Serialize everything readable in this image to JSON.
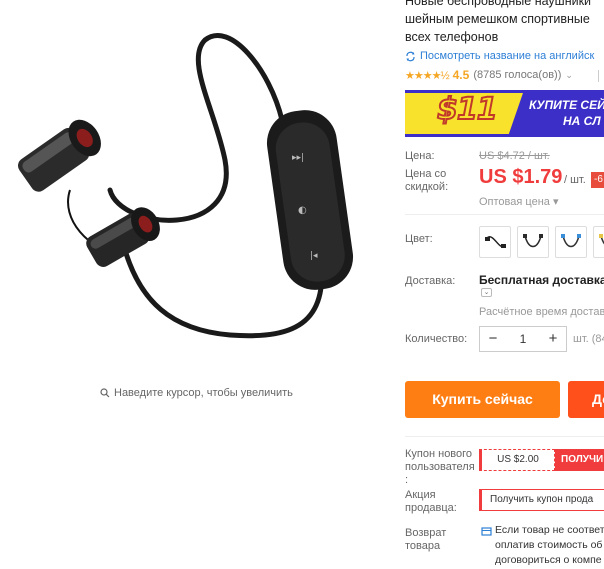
{
  "gallery": {
    "zoom_hint": "Наведите курсор, чтобы увеличить"
  },
  "product": {
    "title_lines": [
      "Новые беспроводные наушники",
      "шейным ремешком спортивные",
      "всех телефонов"
    ],
    "translate_link": "Посмотреть название на английск",
    "rating": {
      "stars": "★★★★½",
      "value": "4.5",
      "votes": "(8785 голоса(ов))"
    }
  },
  "banner": {
    "amount": "$11",
    "line1": "КУПИТЕ СЕЙ",
    "line2": "НА СЛ"
  },
  "pricing": {
    "old_label": "Цена:",
    "old_price": "US $4.72 / шт.",
    "sale_label": "Цена со скидкой:",
    "sale_price": "US $1.79",
    "per_unit": "/ шт.",
    "discount": "-6",
    "wholesale": "Оптовая цена ▾"
  },
  "options": {
    "color_label": "Цвет:",
    "swatch_colors": [
      "#222222",
      "#2b2b2b",
      "#3a8fd8",
      "#e8c447"
    ]
  },
  "delivery": {
    "label": "Доставка:",
    "value": "Бесплатная доставка в",
    "chevron": "⌄",
    "time": "Расчётное время доставк"
  },
  "quantity": {
    "label": "Количество:",
    "minus": "−",
    "value": "1",
    "plus": "+",
    "unit": "шт. (84"
  },
  "actions": {
    "buy_now": "Купить сейчас",
    "add_to_cart": "До"
  },
  "coupons": {
    "new_user_label": "Купон нового пользователя :",
    "new_user_amount": "US $2.00",
    "new_user_get": "ПОЛУЧИ",
    "seller_label": "Акция продавца:",
    "seller_promo": "Получить купон прода"
  },
  "returns": {
    "label": "Возврат товара",
    "text_lines": [
      "Если товар не соответ",
      "оплатив стоимость об",
      "договориться о компе"
    ]
  },
  "colors": {
    "accent_orange": "#ff7e14",
    "sale_red": "#f03c3c",
    "banner_purple": "#3c2fc8",
    "banner_yellow": "#f9e22b",
    "link_blue": "#2d7fd6"
  }
}
